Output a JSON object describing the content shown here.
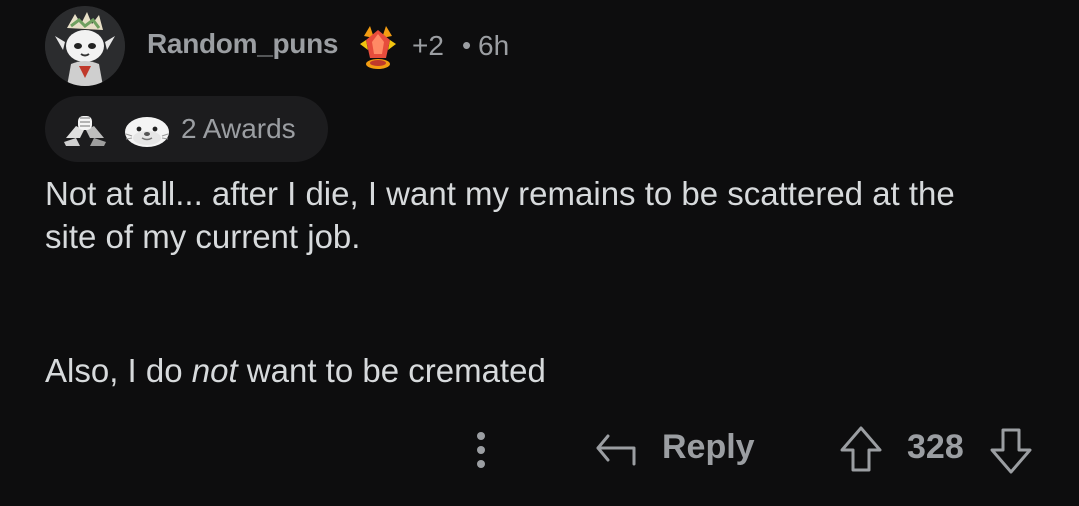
{
  "comment": {
    "author": "Random_puns",
    "flair_icon": "crystal-award-icon",
    "flair_count": "+2",
    "separator": "•",
    "age": "6h",
    "awards": {
      "icons": [
        "arm-wrestling-award-icon",
        "seal-award-icon"
      ],
      "label": "2 Awards"
    },
    "body": {
      "line1": "Not at all... after I die, I want my remains to be scattered at the",
      "line2": "site of my current job.",
      "line3_before": "Also, I do ",
      "line3_emphasis": "not",
      "line3_after": " want to be cremated"
    },
    "actions": {
      "more_icon": "more-vertical-icon",
      "reply_icon": "reply-arrow-icon",
      "reply_label": "Reply",
      "upvote_icon": "upvote-arrow-icon",
      "score": "328",
      "downvote_icon": "downvote-arrow-icon"
    }
  },
  "colors": {
    "background": "#0d0d0e",
    "text_primary": "#d7dadc",
    "text_secondary": "#9b9ea2",
    "pill_background": "#1c1c1e"
  }
}
